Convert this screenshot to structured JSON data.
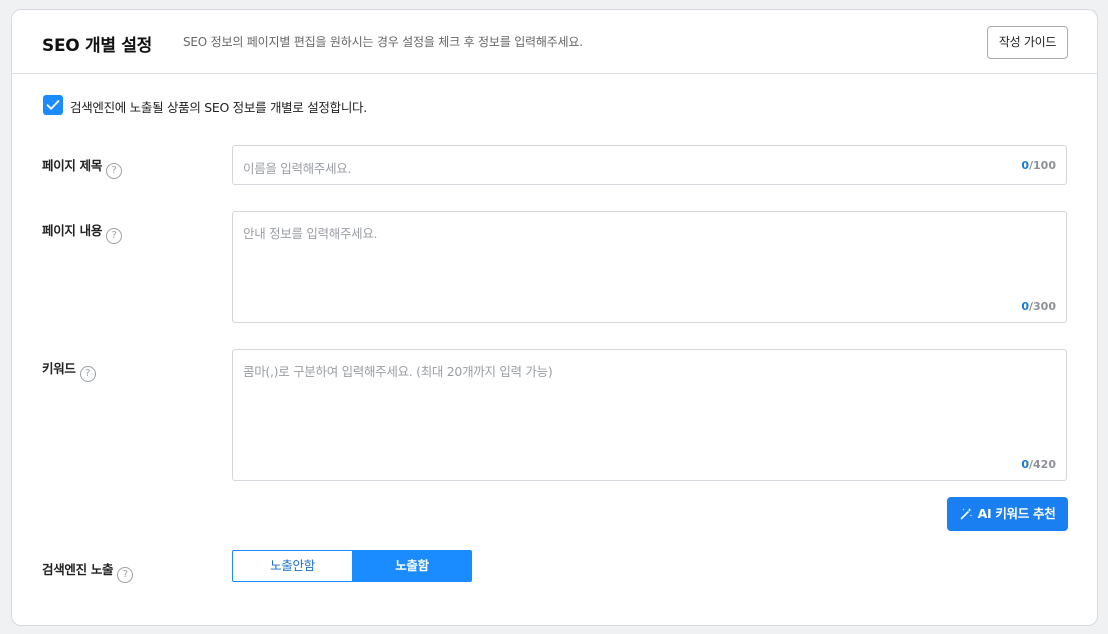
{
  "header": {
    "title": "SEO 개별 설정",
    "description": "SEO 정보의 페이지별 편집을 원하시는 경우 설정을 체크 후 정보를 입력해주세요.",
    "guide_button": "작성 가이드"
  },
  "checkbox": {
    "checked": true,
    "label": "검색엔진에 노출될 상품의 SEO 정보를 개별로 설정합니다."
  },
  "fields": {
    "page_title": {
      "label": "페이지 제목",
      "placeholder": "이름을 입력해주세요.",
      "count": "0",
      "max": "/100"
    },
    "page_content": {
      "label": "페이지 내용",
      "placeholder": "안내 정보를 입력해주세요.",
      "count": "0",
      "max": "/300"
    },
    "keyword": {
      "label": "키워드",
      "placeholder": "콤마(,)로 구분하여 입력해주세요. (최대 20개까지 입력 가능)",
      "count": "0",
      "max": "/420"
    }
  },
  "ai_button": {
    "label": "AI 키워드 추천",
    "icon": "magic-wand-icon"
  },
  "exposure": {
    "label": "검색엔진 노출",
    "options": [
      "노출안함",
      "노출함"
    ],
    "selected": "노출함"
  },
  "colors": {
    "accent": "#1a8cff",
    "button_primary": "#1a7ff0",
    "counter_current": "#1a7ad9"
  }
}
